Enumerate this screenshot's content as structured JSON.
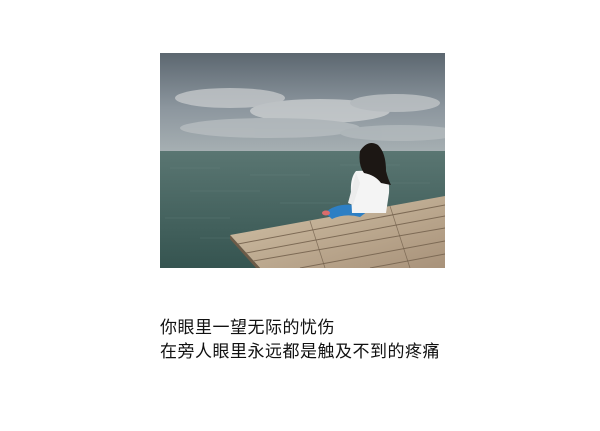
{
  "photo": {
    "subject": "woman-sitting-on-wooden-pier-facing-sea",
    "colors": {
      "sky_top": "#5c6770",
      "sky_mid": "#8c969e",
      "cloud": "#c9ccce",
      "horizon": "#a7b0b3",
      "sea_far": "#4f6d69",
      "sea_near": "#3a5854",
      "pier_light": "#c9b79c",
      "pier_dark": "#8f7a62",
      "shirt": "#f4f4f4",
      "jeans": "#2d7fc4",
      "hair": "#1c1714"
    }
  },
  "caption": {
    "line1": "你眼里一望无际的忧伤",
    "line2": "在旁人眼里永远都是触及不到的疼痛"
  }
}
